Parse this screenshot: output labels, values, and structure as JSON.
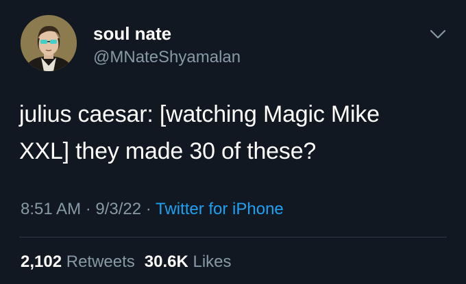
{
  "user": {
    "display_name": "soul nate",
    "handle": "@MNateShyamalan"
  },
  "tweet": {
    "text_line1": "julius caesar: [watching Magic Mike",
    "text_line2": "XXL] they made 30 of these?",
    "time": "8:51 AM",
    "date": "9/3/22",
    "separator": " · ",
    "source": "Twitter for iPhone"
  },
  "stats": {
    "retweets_count": "2,102",
    "retweets_label": "Retweets",
    "likes_count": "30.6K",
    "likes_label": "Likes"
  },
  "colors": {
    "background": "#121821",
    "text_primary": "#ffffff",
    "text_secondary": "#8899a6",
    "link": "#1da1f2"
  },
  "icons": {
    "menu": "chevron-down-icon"
  }
}
